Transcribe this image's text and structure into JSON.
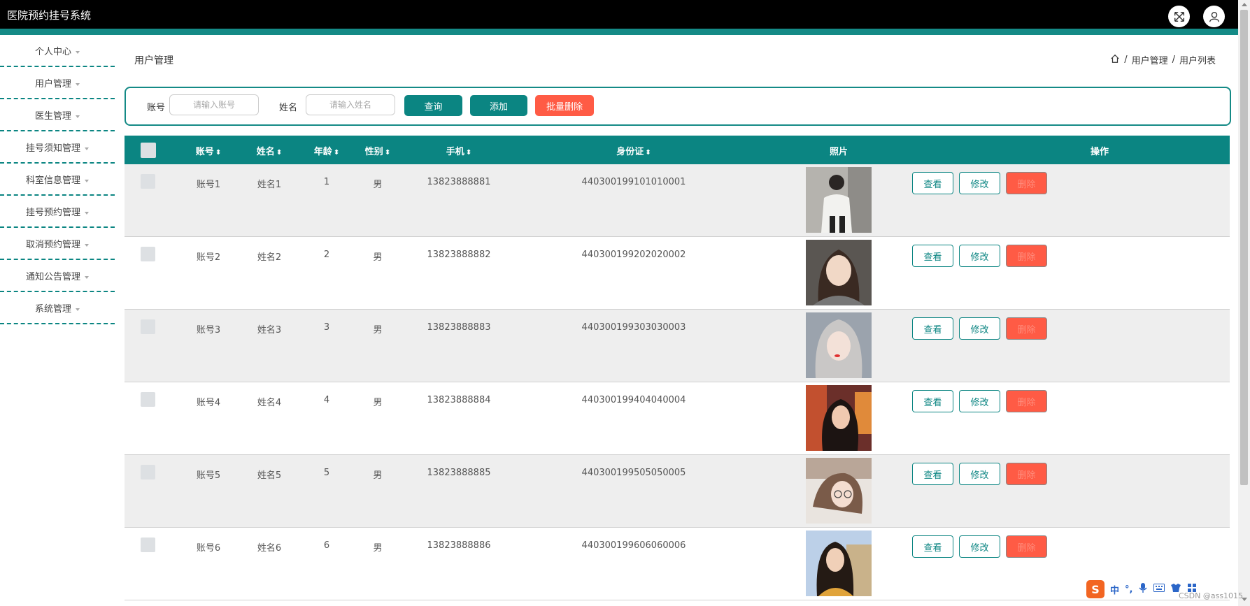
{
  "app": {
    "title": "医院预约挂号系统"
  },
  "sidebar": {
    "items": [
      {
        "label": "个人中心"
      },
      {
        "label": "用户管理"
      },
      {
        "label": "医生管理"
      },
      {
        "label": "挂号须知管理"
      },
      {
        "label": "科室信息管理"
      },
      {
        "label": "挂号预约管理"
      },
      {
        "label": "取消预约管理"
      },
      {
        "label": "通知公告管理"
      },
      {
        "label": "系统管理"
      }
    ]
  },
  "page": {
    "title": "用户管理",
    "breadcrumb": [
      "用户管理",
      "用户列表"
    ],
    "breadcrumb_sep": "/"
  },
  "search": {
    "account_label": "账号",
    "account_placeholder": "请输入账号",
    "name_label": "姓名",
    "name_placeholder": "请输入姓名",
    "query_button": "查询",
    "add_button": "添加",
    "batch_delete_button": "批量删除"
  },
  "table": {
    "headers": {
      "account": "账号",
      "name": "姓名",
      "age": "年龄",
      "gender": "性别",
      "phone": "手机",
      "id_card": "身份证",
      "photo": "照片",
      "actions": "操作"
    },
    "sort_glyph": "⬍",
    "rows": [
      {
        "account": "账号1",
        "name": "姓名1",
        "age": "1",
        "gender": "男",
        "phone": "13823888881",
        "id_card": "440300199101010001"
      },
      {
        "account": "账号2",
        "name": "姓名2",
        "age": "2",
        "gender": "男",
        "phone": "13823888882",
        "id_card": "440300199202020002"
      },
      {
        "account": "账号3",
        "name": "姓名3",
        "age": "3",
        "gender": "男",
        "phone": "13823888883",
        "id_card": "440300199303030003"
      },
      {
        "account": "账号4",
        "name": "姓名4",
        "age": "4",
        "gender": "男",
        "phone": "13823888884",
        "id_card": "440300199404040004"
      },
      {
        "account": "账号5",
        "name": "姓名5",
        "age": "5",
        "gender": "男",
        "phone": "13823888885",
        "id_card": "440300199505050005"
      },
      {
        "account": "账号6",
        "name": "姓名6",
        "age": "6",
        "gender": "男",
        "phone": "13823888886",
        "id_card": "440300199606060006"
      }
    ],
    "row_actions": {
      "view": "查看",
      "edit": "修改",
      "delete": "删除"
    }
  },
  "ime": {
    "logo": "S",
    "mode": "中",
    "punct": "°,",
    "watermark": "CSDN @ass1015"
  },
  "colors": {
    "accent": "#0b8582",
    "danger": "#ff5b45",
    "topbar": "#000000"
  },
  "icons": [
    "fullscreen-icon",
    "user-icon",
    "home-icon",
    "caret-down-icon",
    "sort-icon",
    "microphone-icon",
    "keyboard-icon"
  ]
}
